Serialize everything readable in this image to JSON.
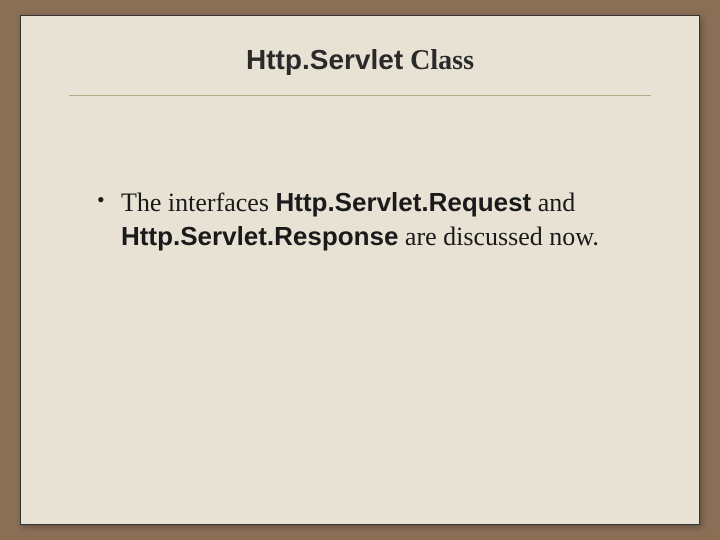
{
  "title": {
    "part1": "Http.Servlet",
    "part2": "Class"
  },
  "bullet": {
    "prefix": "The interfaces ",
    "term1": "Http.Servlet.Request",
    "mid": " and ",
    "term2": "Http.Servlet.Response",
    "suffix": " are discussed now."
  }
}
